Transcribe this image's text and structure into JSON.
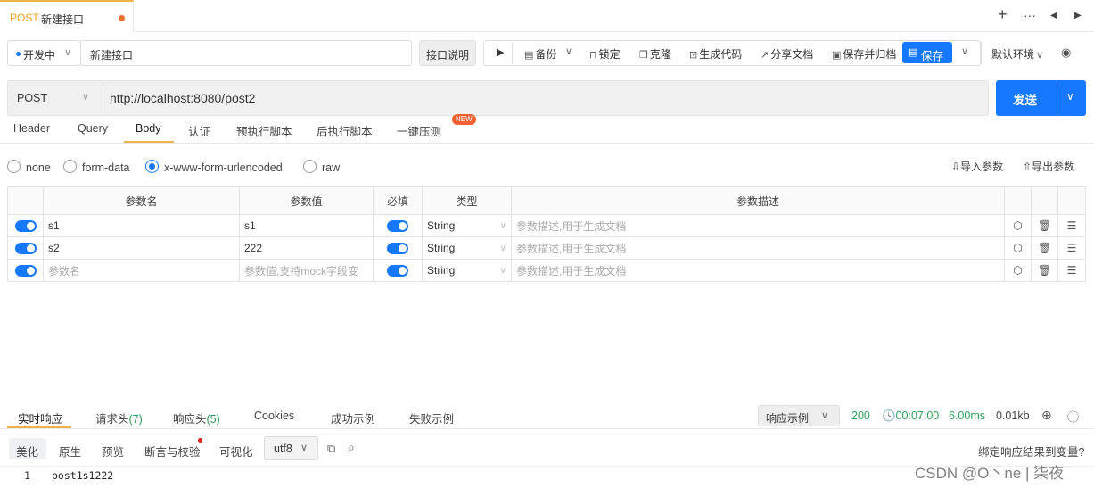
{
  "tab": {
    "method": "POST",
    "title": "新建接口"
  },
  "toolbar_top": {
    "plus_icon": "plus-icon",
    "more_icon": "more-icon"
  },
  "status_select": {
    "label": "开发中",
    "color": "#1677ff"
  },
  "name_input": {
    "value": "新建接口"
  },
  "doc_button": {
    "label": "接口说明"
  },
  "actions": {
    "backup": "备份",
    "lock": "锁定",
    "clone": "克隆",
    "gen_code": "生成代码",
    "share_doc": "分享文档",
    "save_archive": "保存并归档",
    "save": "保存",
    "env": "默认环境"
  },
  "request": {
    "method": "POST",
    "url": "http://localhost:8080/post2",
    "send_label": "发送"
  },
  "subtabs": [
    "Header",
    "Query",
    "Body",
    "认证",
    "预执行脚本",
    "后执行脚本",
    "一键压测"
  ],
  "new_badge": "NEW",
  "body_modes": [
    "none",
    "form-data",
    "x-www-form-urlencoded",
    "raw"
  ],
  "import_label": "导入参数",
  "export_label": "导出参数",
  "table": {
    "headers": [
      "参数名",
      "参数值",
      "必填",
      "类型",
      "参数描述"
    ],
    "rows": [
      {
        "name": "s1",
        "value": "s1",
        "type": "String",
        "desc": "参数描述,用于生成文档"
      },
      {
        "name": "s2",
        "value": "222",
        "type": "String",
        "desc": "参数描述,用于生成文档"
      }
    ],
    "placeholder": {
      "name": "参数名",
      "value": "参数值,支持mock字段变",
      "type": "String",
      "desc": "参数描述,用于生成文档"
    }
  },
  "response": {
    "tabs": [
      {
        "label": "实时响应",
        "count": ""
      },
      {
        "label": "请求头",
        "count": "(7)"
      },
      {
        "label": "响应头",
        "count": "(5)"
      },
      {
        "label": "Cookies",
        "count": ""
      },
      {
        "label": "成功示例",
        "count": ""
      },
      {
        "label": "失败示例",
        "count": ""
      }
    ],
    "example_select": "响应示例",
    "status": "200",
    "time_total": "00:07:00",
    "time_ms": "6.00ms",
    "size": "0.01kb",
    "views": [
      "美化",
      "原生",
      "预览",
      "断言与校验",
      "可视化"
    ],
    "encoding": "utf8",
    "bind_label": "绑定响应结果到变量?",
    "line_no": "1",
    "body_text": "post1s1222"
  },
  "watermark": "CSDN @O丶ne | 柒夜",
  "colors": {
    "accent": "#1677ff",
    "tab_underline": "#f0b34c",
    "success": "#2e9e5a",
    "new_badge": "#f06030"
  }
}
